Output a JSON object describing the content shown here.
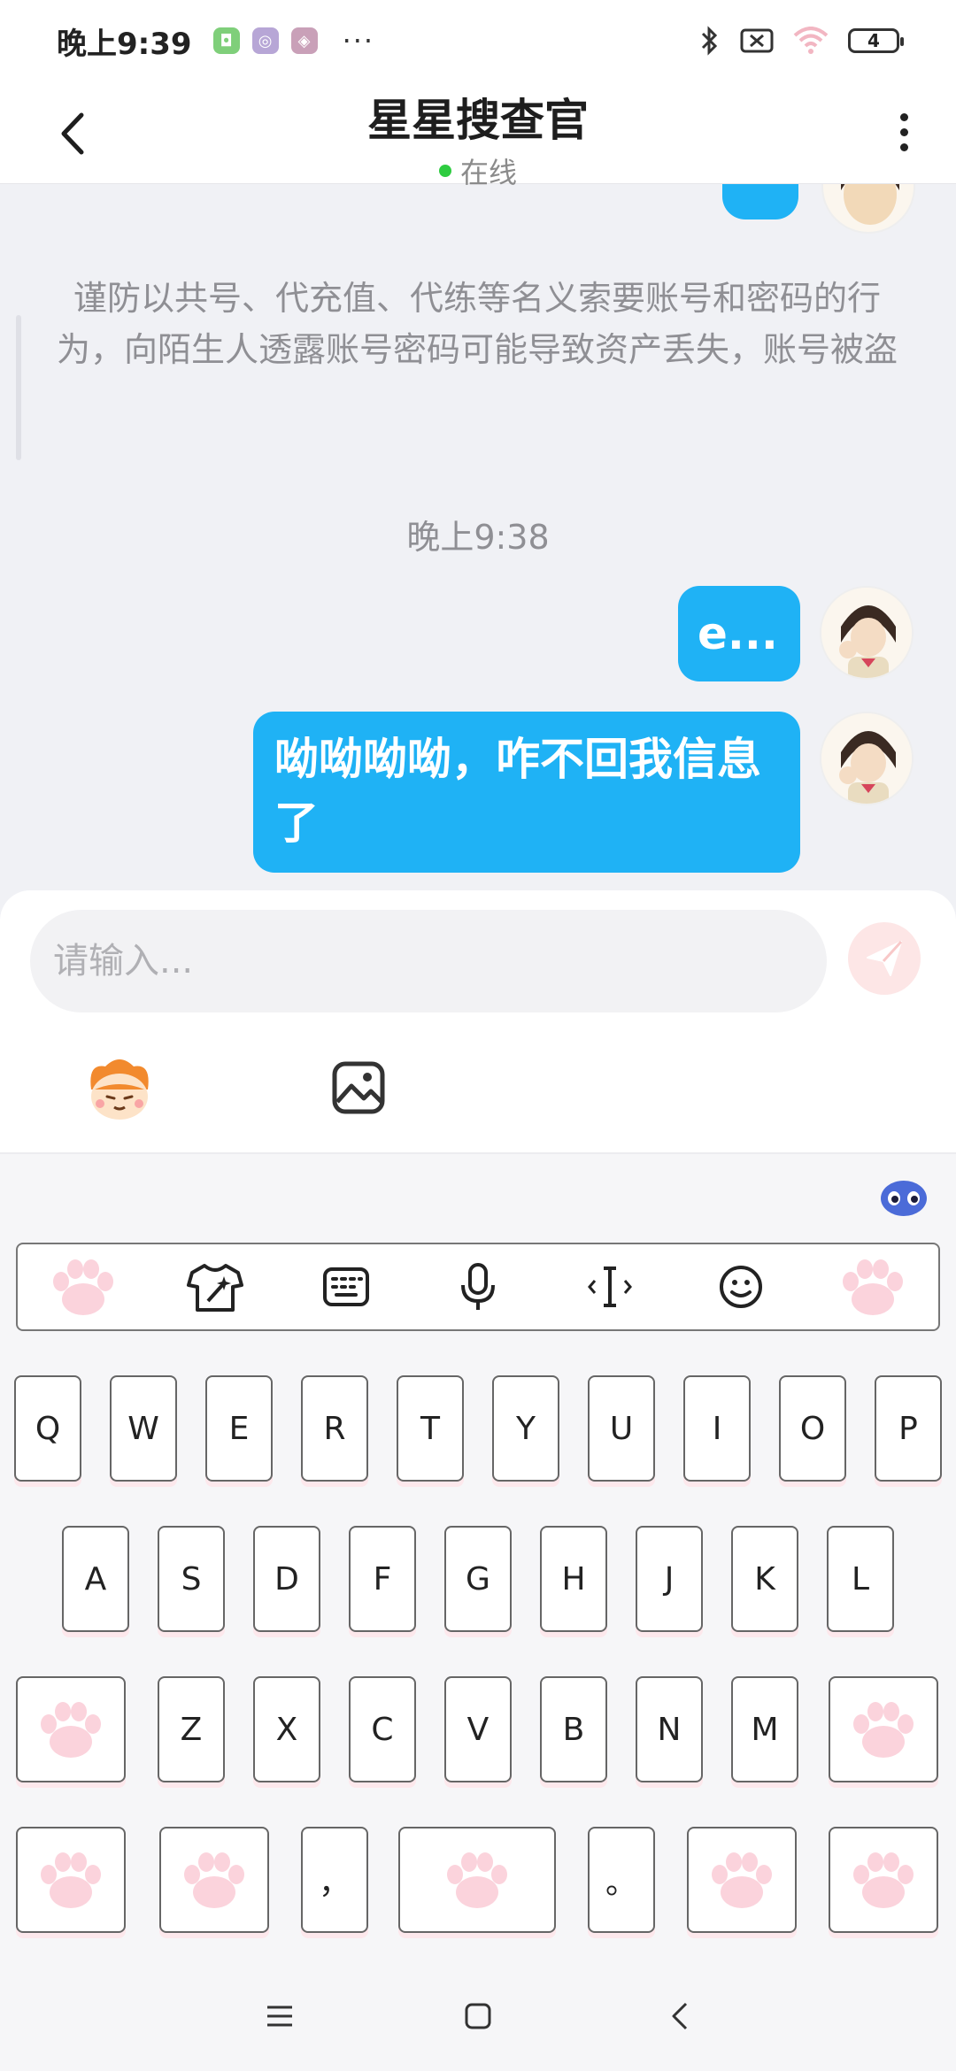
{
  "status_bar": {
    "time": "晚上9:39",
    "more_dots": "···",
    "battery": "4"
  },
  "header": {
    "title": "星星搜查官",
    "status": "在线"
  },
  "chat": {
    "notice": "谨防以共号、代充值、代练等名义索要账号和密码的行为，向陌生人透露账号密码可能导致资产丢失，账号被盗",
    "timestamp": "晚上9:38",
    "messages": [
      {
        "text": "e..."
      },
      {
        "text": "呦呦呦呦，咋不回我信息了"
      }
    ]
  },
  "input": {
    "placeholder": "请输入..."
  },
  "keyboard": {
    "row1": [
      "Q",
      "W",
      "E",
      "R",
      "T",
      "Y",
      "U",
      "I",
      "O",
      "P"
    ],
    "row2": [
      "A",
      "S",
      "D",
      "F",
      "G",
      "H",
      "J",
      "K",
      "L"
    ],
    "row3": [
      "Z",
      "X",
      "C",
      "V",
      "B",
      "N",
      "M"
    ],
    "comma": "，",
    "period": "。"
  },
  "colors": {
    "accent": "#1fb2f5",
    "paw": "#fbd3dc"
  }
}
